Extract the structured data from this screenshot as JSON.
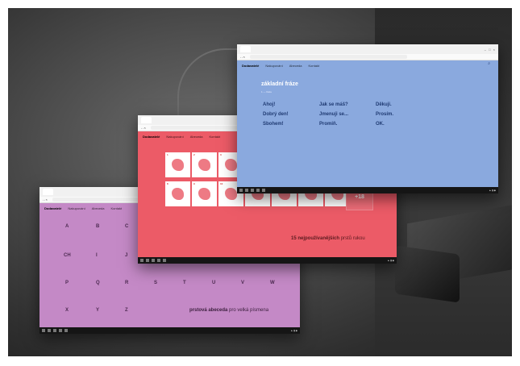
{
  "purple_window": {
    "nav": [
      "Dodavatelé",
      "Nakupování",
      "Abeceda",
      "Kontakt"
    ],
    "letters": [
      "A",
      "B",
      "C",
      "CH",
      "I",
      "J",
      "P",
      "Q",
      "R",
      "S",
      "T",
      "U",
      "V",
      "W",
      "X",
      "Y",
      "Z"
    ],
    "claim_bold": "prstová abeceda",
    "claim_rest": " pro velká písmena"
  },
  "red_window": {
    "nav": [
      "Dodavatelé",
      "Nakupování",
      "Abeceda",
      "Kontakt"
    ],
    "cell_numbers": [
      "1",
      "2",
      "3",
      "",
      "",
      "",
      "8",
      "9",
      "10",
      "",
      "",
      "",
      "",
      ""
    ],
    "more": "+18",
    "claim_bold": "15 nejpoužívanějších",
    "claim_rest": " prstů rukou"
  },
  "blue_window": {
    "nav": [
      "Dodavatelé",
      "Nakupování",
      "Abeceda",
      "Kontakt"
    ],
    "title": "základní fráze",
    "subtitle": "1 — fráze",
    "phrases": [
      [
        "Ahoj!",
        "Jak se máš?",
        "Děkuji."
      ],
      [
        "Dobrý den!",
        "Jmenuji se...",
        "Prosím."
      ],
      [
        "Sbohem!",
        "Promiň.",
        "OK."
      ]
    ]
  },
  "colors": {
    "purple": "#c489c6",
    "red": "#ec5b67",
    "blue": "#8aa9de"
  }
}
